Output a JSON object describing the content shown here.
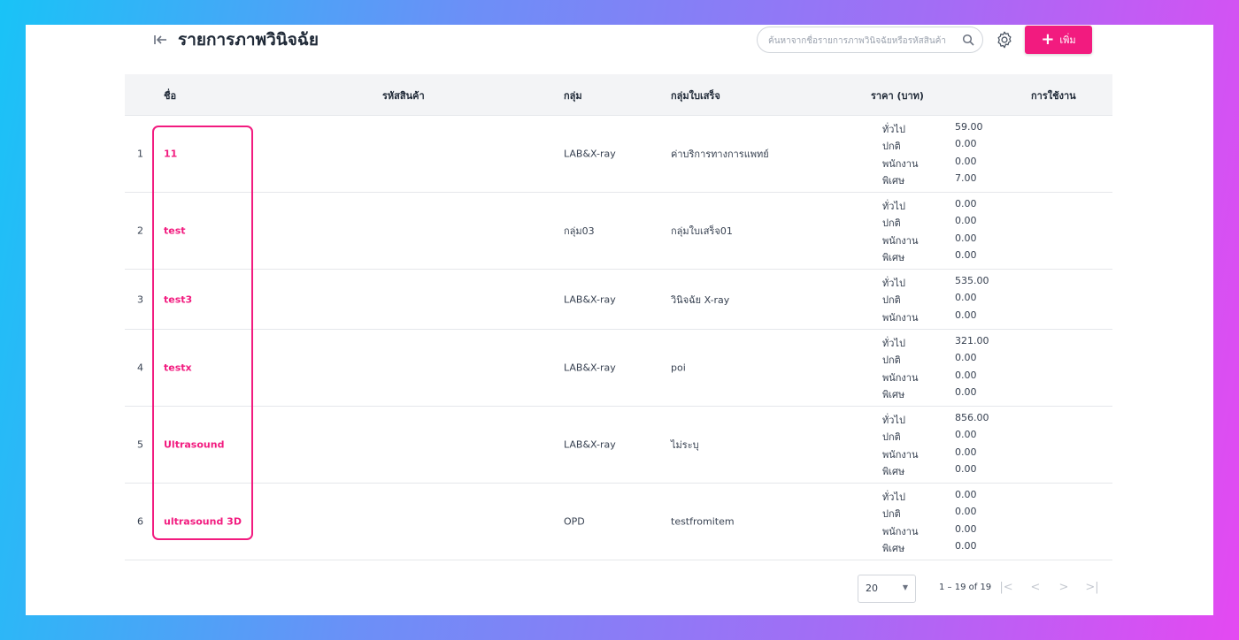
{
  "header": {
    "title": "รายการภาพวินิจฉัย",
    "search_placeholder": "ค้นหาจากชื่อรายการภาพวินิจฉัยหรือรหัสสินค้า",
    "add_label": "เพิ่ม",
    "back_icon": "back-to-start-icon",
    "settings_icon": "gear-icon"
  },
  "table": {
    "columns": {
      "name": "ชื่อ",
      "code": "รหัสสินค้า",
      "group": "กลุ่ม",
      "receipt_group": "กลุ่มใบเสร็จ",
      "price": "ราคา (บาท)",
      "usage": "การใช้งาน"
    },
    "rows": [
      {
        "num": "1",
        "name": "11",
        "code": "",
        "group": "LAB&X-ray",
        "receipt": "ค่าบริการทางการแพทย์",
        "prices": [
          {
            "label": "ทั่วไป",
            "value": "59.00"
          },
          {
            "label": "ปกติ",
            "value": "0.00"
          },
          {
            "label": "พนักงาน",
            "value": "0.00"
          },
          {
            "label": "พิเศษ",
            "value": "7.00"
          }
        ]
      },
      {
        "num": "2",
        "name": "test",
        "code": "",
        "group": "กลุ่ม03",
        "receipt": "กลุ่มใบเสร็จ01",
        "prices": [
          {
            "label": "ทั่วไป",
            "value": "0.00"
          },
          {
            "label": "ปกติ",
            "value": "0.00"
          },
          {
            "label": "พนักงาน",
            "value": "0.00"
          },
          {
            "label": "พิเศษ",
            "value": "0.00"
          }
        ]
      },
      {
        "num": "3",
        "name": "test3",
        "code": "",
        "group": "LAB&X-ray",
        "receipt": "วินิจฉัย X-ray",
        "prices": [
          {
            "label": "ทั่วไป",
            "value": "535.00"
          },
          {
            "label": "ปกติ",
            "value": "0.00"
          },
          {
            "label": "พนักงาน",
            "value": "0.00"
          }
        ]
      },
      {
        "num": "4",
        "name": "testx",
        "code": "",
        "group": "LAB&X-ray",
        "receipt": "poi",
        "prices": [
          {
            "label": "ทั่วไป",
            "value": "321.00"
          },
          {
            "label": "ปกติ",
            "value": "0.00"
          },
          {
            "label": "พนักงาน",
            "value": "0.00"
          },
          {
            "label": "พิเศษ",
            "value": "0.00"
          }
        ]
      },
      {
        "num": "5",
        "name": "Ultrasound",
        "code": "",
        "group": "LAB&X-ray",
        "receipt": "ไม่ระบุ",
        "prices": [
          {
            "label": "ทั่วไป",
            "value": "856.00"
          },
          {
            "label": "ปกติ",
            "value": "0.00"
          },
          {
            "label": "พนักงาน",
            "value": "0.00"
          },
          {
            "label": "พิเศษ",
            "value": "0.00"
          }
        ]
      },
      {
        "num": "6",
        "name": "ultrasound 3D",
        "code": "",
        "group": "OPD",
        "receipt": "testfromitem",
        "prices": [
          {
            "label": "ทั่วไป",
            "value": "0.00"
          },
          {
            "label": "ปกติ",
            "value": "0.00"
          },
          {
            "label": "พนักงาน",
            "value": "0.00"
          },
          {
            "label": "พิเศษ",
            "value": "0.00"
          }
        ]
      }
    ]
  },
  "pagination": {
    "page_size": "20",
    "range": "1 – 19 of 19"
  },
  "colors": {
    "accent": "#f21b7f",
    "header_bg": "#f3f4f6"
  }
}
